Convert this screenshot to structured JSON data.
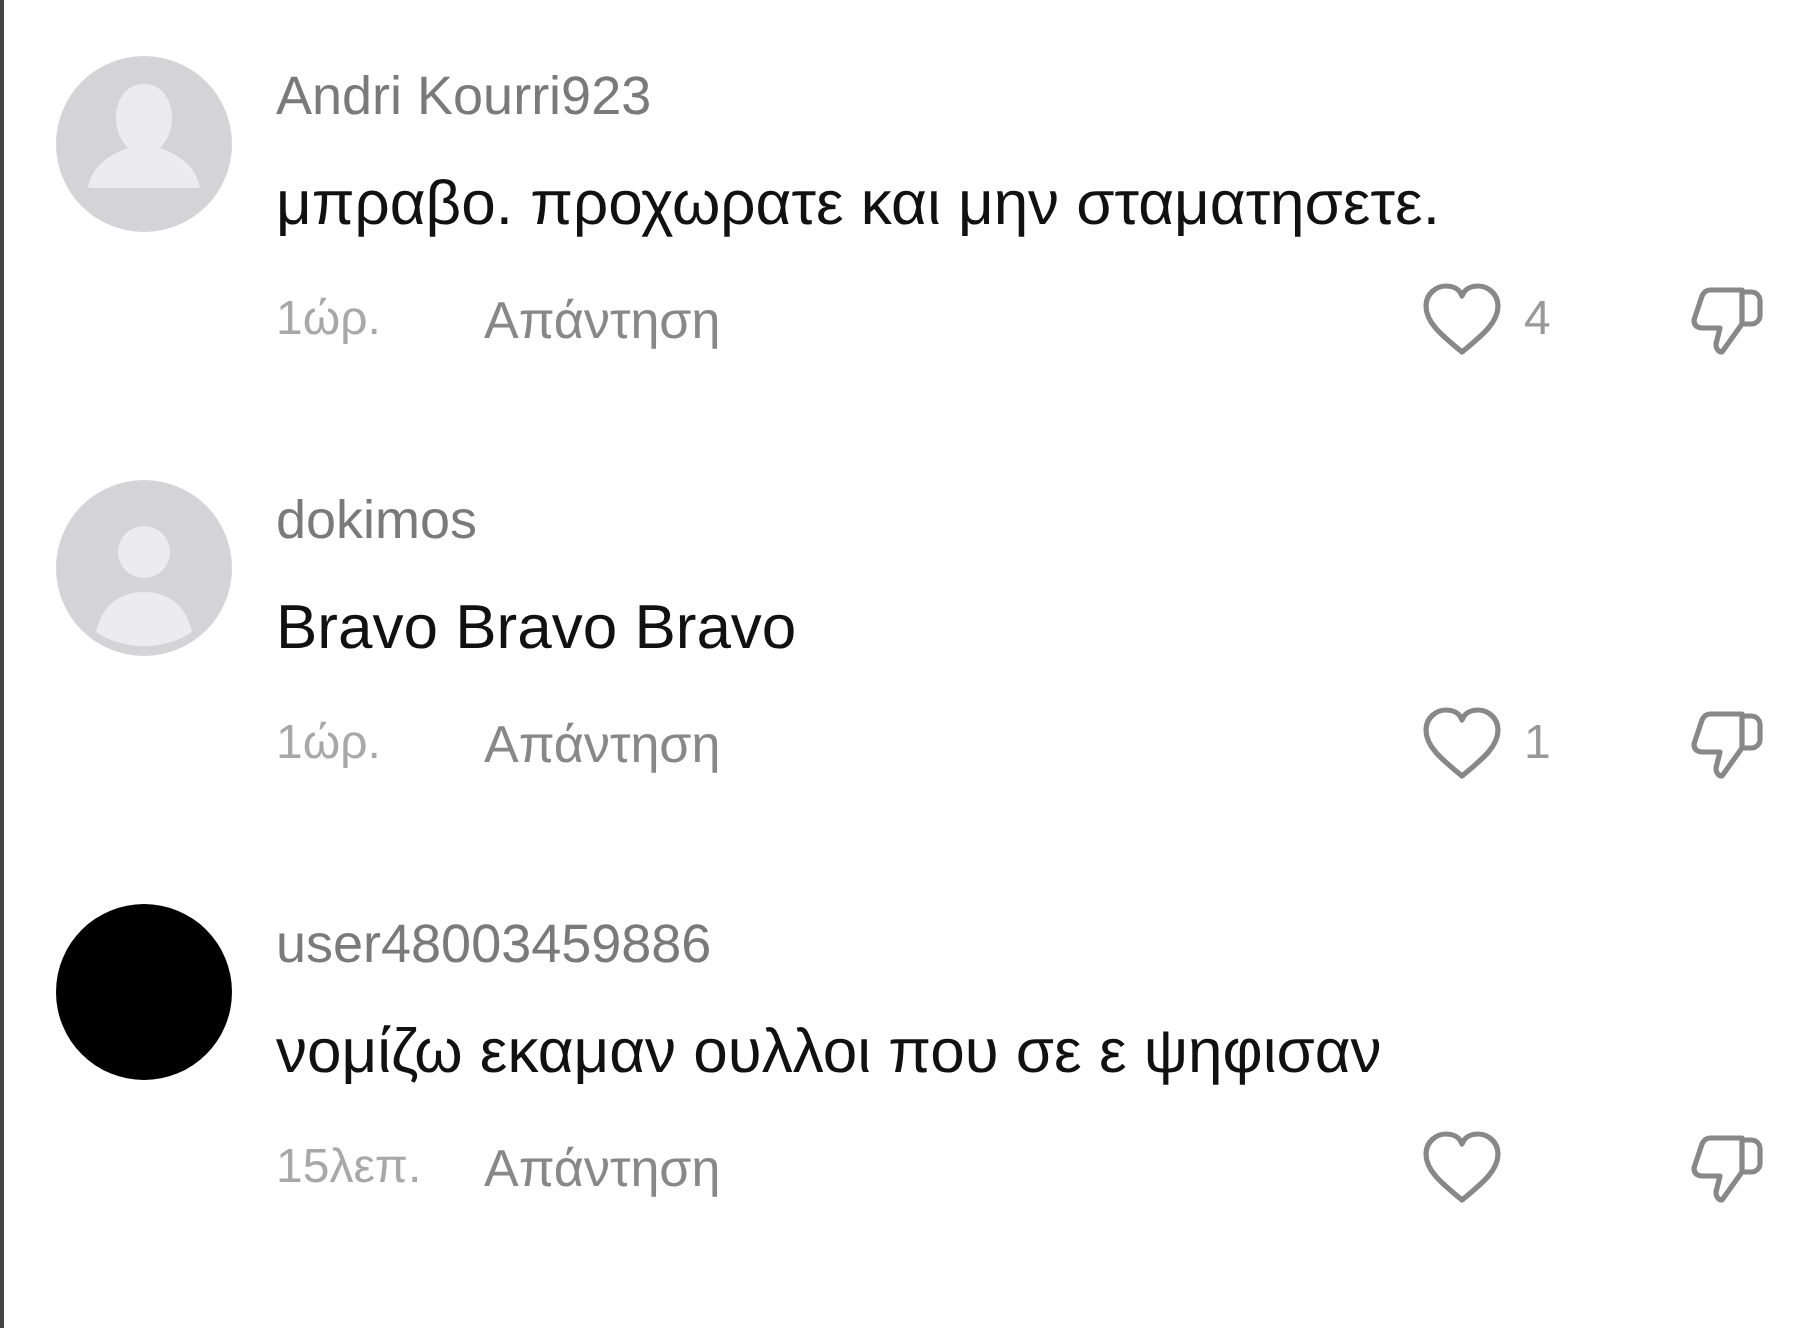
{
  "comments": [
    {
      "username": "Andri Kourri923",
      "avatar": {
        "kind": "silhouette"
      },
      "text": "μπραβο. προχωρατε και μην σταματησετε.",
      "time": "1ώρ.",
      "reply": "Απάντηση",
      "likes": "4"
    },
    {
      "username": "dokimos",
      "avatar": {
        "kind": "person"
      },
      "text": "Bravo Bravo Bravo",
      "time": "1ώρ.",
      "reply": "Απάντηση",
      "likes": "1"
    },
    {
      "username": "user48003459886",
      "avatar": {
        "kind": "dark"
      },
      "text": "νομίζω εκαμαν ουλλοι που σε ε ψηφισαν",
      "time": "15λεπ.",
      "reply": "Απάντηση"
    }
  ]
}
